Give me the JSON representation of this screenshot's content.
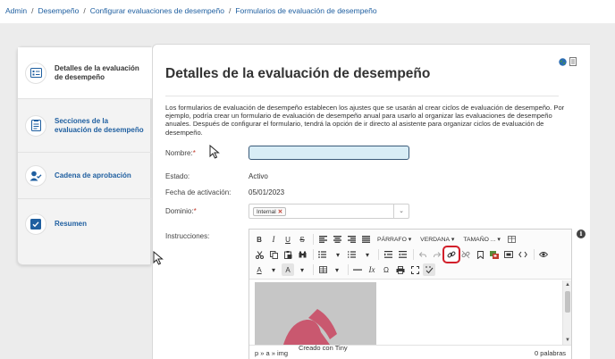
{
  "breadcrumb": {
    "items": [
      "Admin",
      "Desempeño",
      "Configurar evaluaciones de desempeño"
    ],
    "current": "Formularios de evaluación de desempeño"
  },
  "sidebar": {
    "items": [
      {
        "label": "Detalles de la evaluación de desempeño",
        "icon": "form-icon",
        "active": true
      },
      {
        "label": "Secciones de la evaluación de desempeño",
        "icon": "document-list-icon",
        "active": false
      },
      {
        "label": "Cadena de aprobación",
        "icon": "user-approval-icon",
        "active": false
      },
      {
        "label": "Resumen",
        "icon": "checklist-icon",
        "active": false
      }
    ]
  },
  "main": {
    "title": "Detalles de la evaluación de desempeño",
    "description": "Los formularios de evaluación de desempeño establecen los ajustes que se usarán al crear ciclos de evaluación de desempeño. Por ejemplo, podría crear un formulario de evaluación de desempeño anual para usarlo al organizar las evaluaciones de desempeño anuales. Después de configurar el formulario, tendrá la opción de ir directo al asistente para organizar ciclos de evaluación de desempeño.",
    "header_icons": [
      "globe-icon",
      "document-icon"
    ]
  },
  "form": {
    "name_label": "Nombre:",
    "name_required": "*",
    "name_value": "",
    "status_label": "Estado:",
    "status_value": "Activo",
    "activation_label": "Fecha de activación:",
    "activation_value": "05/01/2023",
    "domain_label": "Dominio:",
    "domain_required": "*",
    "domain_tag": "Internal",
    "domain_remove": "✕",
    "domain_caret": "⌄",
    "instructions_label": "Instrucciones:",
    "info_icon": "i"
  },
  "editor": {
    "row1": {
      "bold": "B",
      "italic": "I",
      "underline": "U",
      "strike": "S",
      "paragraph": "PÁRRAFO",
      "font": "VERDANA",
      "size": "TAMAÑO ...",
      "caret": "▾"
    },
    "row3": {
      "font_color": "A",
      "bg_color": "A",
      "clear_format": "Ix",
      "omega": "Ω"
    },
    "statusbar": {
      "path": "p » a » img",
      "brand": "Creado con Tiny",
      "wordcount": "0 palabras"
    },
    "scroll_up": "▲",
    "scroll_down": "▼"
  },
  "colors": {
    "link_blue": "#1f5fa0",
    "required_red": "#c0392b",
    "highlight_red": "#d21f2a",
    "input_fill": "#d8edf6",
    "image_shape": "#c9586f"
  }
}
